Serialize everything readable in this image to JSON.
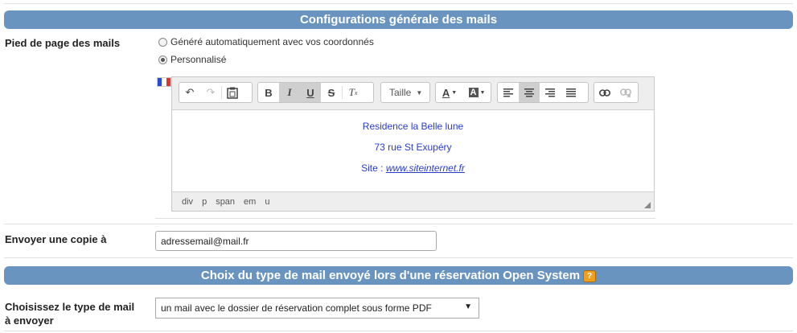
{
  "section1": {
    "title": "Configurations générale des mails"
  },
  "footer": {
    "label": "Pied de page des mails",
    "radio_auto": "Généré automatiquement avec vos coordonnés",
    "radio_custom": "Personnalisé",
    "selected": "custom"
  },
  "editor": {
    "toolbar": {
      "size_label": "Taille"
    },
    "content": {
      "line1": "Residence la Belle lune",
      "line2": "73 rue St Exupéry",
      "line3_prefix": "Site : ",
      "line3_link": "www.siteinternet.fr"
    },
    "path": [
      "div",
      "p",
      "span",
      "em",
      "u"
    ]
  },
  "copy": {
    "label": "Envoyer une copie à",
    "value": "adressemail@mail.fr"
  },
  "section2": {
    "title": "Choix du type de mail envoyé lors d'une réservation Open System",
    "help": "?"
  },
  "mailtype": {
    "label_line1": "Choisissez le type de mail",
    "label_line2": "à envoyer",
    "selected": "un mail avec le dossier de réservation complet sous forme PDF"
  },
  "colors": {
    "header_bg": "#6a94c0",
    "content_text": "#2a3ccc",
    "help_badge": "#f0a020"
  }
}
